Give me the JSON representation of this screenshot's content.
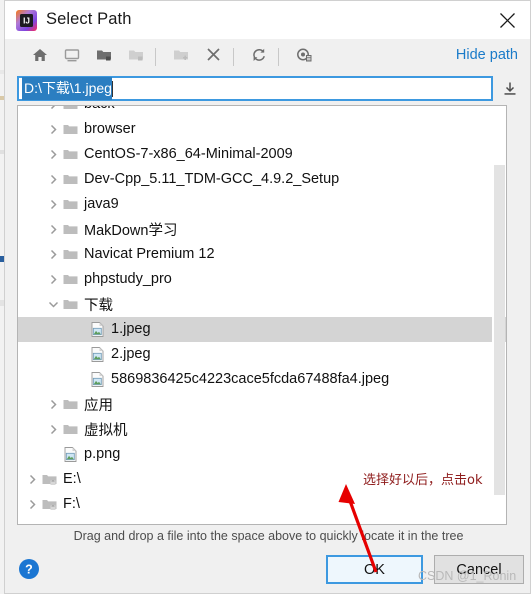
{
  "window": {
    "title": "Select Path",
    "app_icon": "intellij-idea-icon",
    "close_icon": "close-icon"
  },
  "toolbar": {
    "buttons": [
      {
        "name": "home-icon",
        "label": "Home",
        "enabled": true
      },
      {
        "name": "desktop-icon",
        "label": "Desktop",
        "enabled": true
      },
      {
        "name": "project-folder-icon",
        "label": "Project Directory",
        "enabled": true
      },
      {
        "name": "module-folder-icon",
        "label": "Module Directory",
        "enabled": false
      },
      {
        "name": "new-folder-icon",
        "label": "New Folder",
        "enabled": false
      },
      {
        "name": "delete-icon",
        "label": "Delete",
        "enabled": true
      },
      {
        "name": "refresh-icon",
        "label": "Refresh",
        "enabled": true
      },
      {
        "name": "show-hidden-icon",
        "label": "Show Hidden Files and Directories",
        "enabled": true
      }
    ],
    "hide_path_label": "Hide path"
  },
  "path_field": {
    "value": "D:\\下载\\1.jpeg",
    "placeholder": "",
    "selected": true,
    "download_icon": "download-icon"
  },
  "tree": {
    "rows": [
      {
        "label": "back",
        "indent": "lvl2",
        "twisty": "collapsed",
        "icon": "folder-icon",
        "selected": false
      },
      {
        "label": "browser",
        "indent": "lvl2",
        "twisty": "collapsed",
        "icon": "folder-icon",
        "selected": false
      },
      {
        "label": "CentOS-7-x86_64-Minimal-2009",
        "indent": "lvl2",
        "twisty": "collapsed",
        "icon": "folder-icon",
        "selected": false
      },
      {
        "label": "Dev-Cpp_5.11_TDM-GCC_4.9.2_Setup",
        "indent": "lvl2",
        "twisty": "collapsed",
        "icon": "folder-icon",
        "selected": false
      },
      {
        "label": "java9",
        "indent": "lvl2",
        "twisty": "collapsed",
        "icon": "folder-icon",
        "selected": false
      },
      {
        "label": "MakDown学习",
        "indent": "lvl2",
        "twisty": "collapsed",
        "icon": "folder-icon",
        "selected": false
      },
      {
        "label": "Navicat Premium 12",
        "indent": "lvl2",
        "twisty": "collapsed",
        "icon": "folder-icon",
        "selected": false
      },
      {
        "label": "phpstudy_pro",
        "indent": "lvl2",
        "twisty": "collapsed",
        "icon": "folder-icon",
        "selected": false
      },
      {
        "label": "下载",
        "indent": "lvl2",
        "twisty": "expanded",
        "icon": "folder-icon",
        "selected": false
      },
      {
        "label": "1.jpeg",
        "indent": "lvl3",
        "twisty": "none",
        "icon": "image-file-icon",
        "selected": true
      },
      {
        "label": "2.jpeg",
        "indent": "lvl3",
        "twisty": "none",
        "icon": "image-file-icon",
        "selected": false
      },
      {
        "label": "5869836425c4223cace5fcda67488fa4.jpeg",
        "indent": "lvl3",
        "twisty": "none",
        "icon": "image-file-icon",
        "selected": false
      },
      {
        "label": "应用",
        "indent": "lvl2",
        "twisty": "collapsed",
        "icon": "folder-icon",
        "selected": false
      },
      {
        "label": "虚拟机",
        "indent": "lvl2",
        "twisty": "collapsed",
        "icon": "folder-icon",
        "selected": false
      },
      {
        "label": "p.png",
        "indent": "lvl2",
        "twisty": "none",
        "icon": "image-file-icon",
        "selected": false
      },
      {
        "label": "E:\\",
        "indent": "lvl1",
        "twisty": "collapsed",
        "icon": "drive-lock-icon",
        "selected": false
      },
      {
        "label": "F:\\",
        "indent": "lvl1",
        "twisty": "collapsed",
        "icon": "drive-lock-icon",
        "selected": false
      }
    ]
  },
  "footer": {
    "drag_hint": "Drag and drop a file into the space above to quickly locate it in the tree",
    "help_icon": "help-icon",
    "ok_label": "OK",
    "cancel_label": "Cancel"
  },
  "annotation": {
    "text": "选择好以后，点击ok",
    "color": "#8e1b1b",
    "arrow": "red-arrow-pointing-to-ok"
  },
  "watermark": {
    "text": "CSDN @1_Ronin"
  }
}
